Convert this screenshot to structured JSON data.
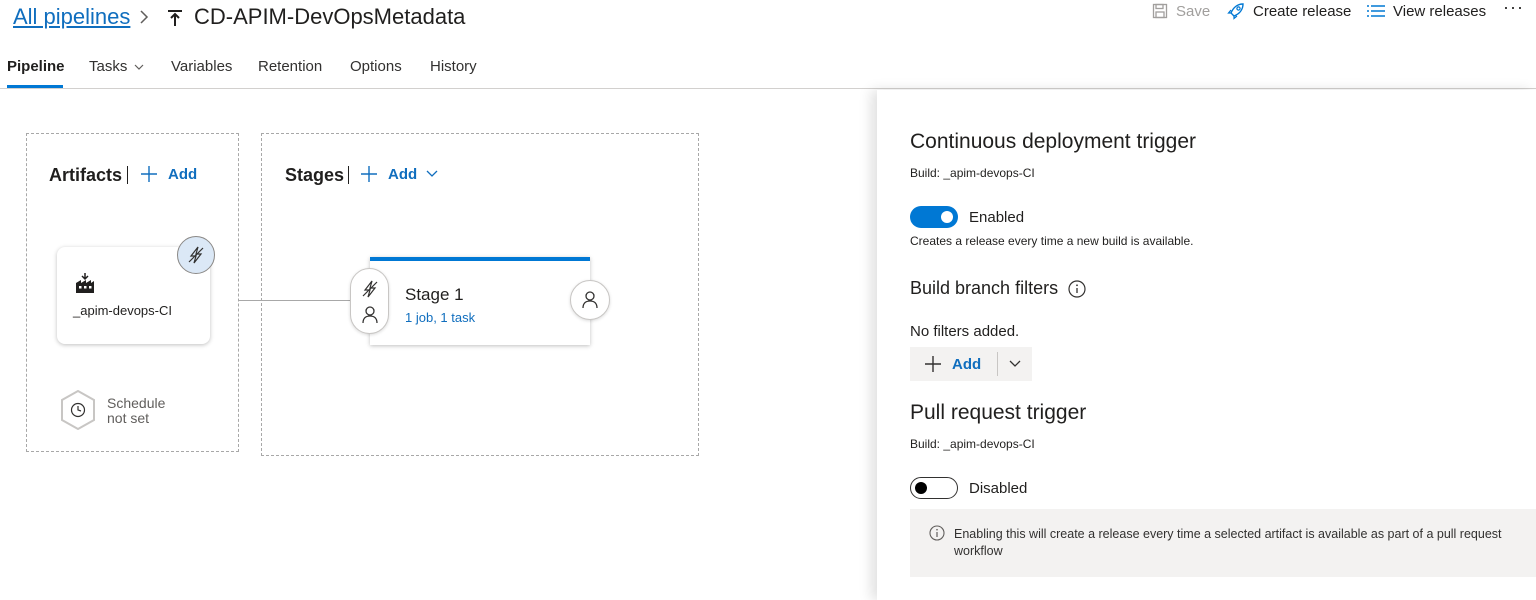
{
  "header": {
    "breadcrumb_link": "All pipelines",
    "pipeline_title": "CD-APIM-DevOpsMetadata",
    "actions": {
      "save": "Save",
      "create_release": "Create release",
      "view_releases": "View releases",
      "more": "···"
    }
  },
  "tabs": [
    {
      "label": "Pipeline",
      "active": true
    },
    {
      "label": "Tasks",
      "active": false
    },
    {
      "label": "Variables",
      "active": false
    },
    {
      "label": "Retention",
      "active": false
    },
    {
      "label": "Options",
      "active": false
    },
    {
      "label": "History",
      "active": false
    }
  ],
  "artifacts": {
    "title": "Artifacts",
    "add_label": "Add",
    "artifact_name": "_apim-devops-CI",
    "schedule_line1": "Schedule",
    "schedule_line2": "not set"
  },
  "stages": {
    "title": "Stages",
    "add_label": "Add",
    "stage_name": "Stage 1",
    "stage_summary": "1 job, 1 task"
  },
  "panel": {
    "cd_title": "Continuous deployment trigger",
    "cd_build": "Build: _apim-devops-CI",
    "cd_toggle_label": "Enabled",
    "cd_toggle_on": true,
    "cd_description": "Creates a release every time a new build is available.",
    "filters_title": "Build branch filters",
    "no_filters": "No filters added.",
    "add_label": "Add",
    "pr_title": "Pull request trigger",
    "pr_build": "Build: _apim-devops-CI",
    "pr_toggle_label": "Disabled",
    "pr_toggle_on": false,
    "pr_info": "Enabling this will create a release every time a selected artifact is available as part of a pull request workflow"
  },
  "colors": {
    "accent": "#0078d4",
    "link": "#106ebe"
  }
}
